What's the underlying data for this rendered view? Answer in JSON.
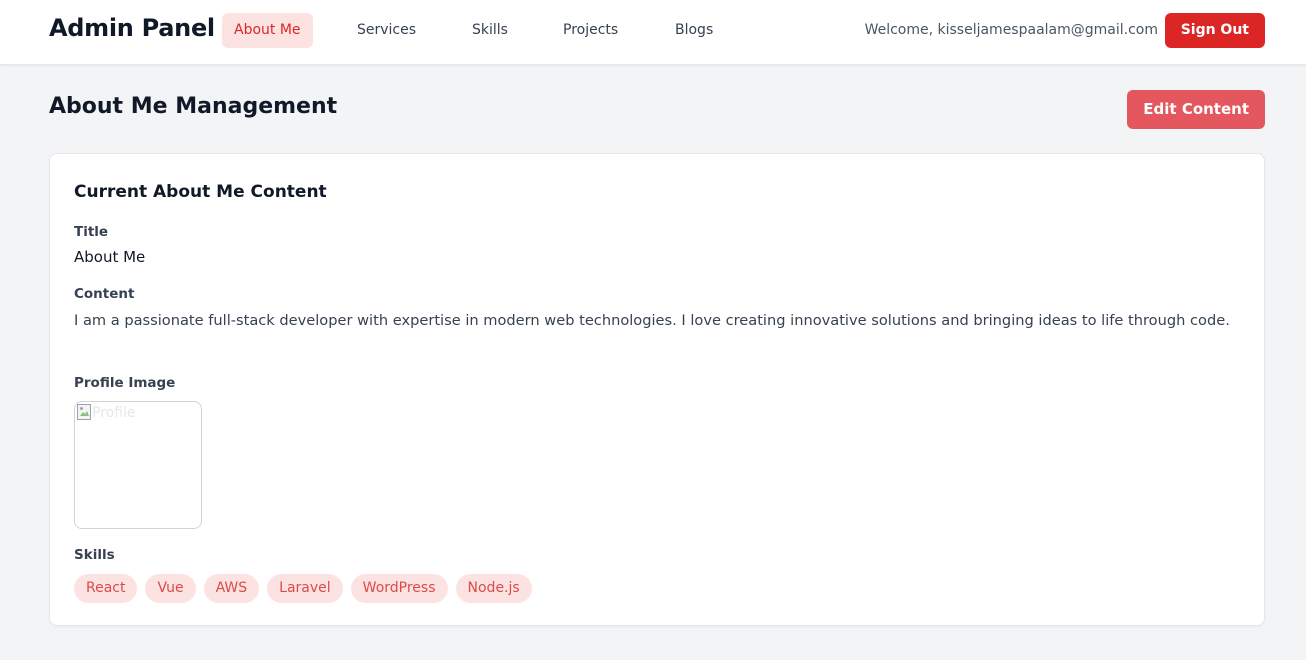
{
  "header": {
    "brand": "Admin Panel",
    "nav": [
      {
        "label": "About Me",
        "active": true
      },
      {
        "label": "Services",
        "active": false
      },
      {
        "label": "Skills",
        "active": false
      },
      {
        "label": "Projects",
        "active": false
      },
      {
        "label": "Blogs",
        "active": false
      }
    ],
    "welcome": "Welcome, kisseljamespaalam@gmail.com",
    "signout_label": "Sign Out"
  },
  "page": {
    "title": "About Me Management",
    "edit_label": "Edit Content"
  },
  "card": {
    "title": "Current About Me Content",
    "title_label": "Title",
    "title_value": "About Me",
    "content_label": "Content",
    "content_value": "I am a passionate full-stack developer with expertise in modern web technologies. I love creating innovative solutions and bringing ideas to life through code.",
    "image_label": "Profile Image",
    "image_alt": "Profile",
    "skills_label": "Skills",
    "skills": [
      "React",
      "Vue",
      "AWS",
      "Laravel",
      "WordPress",
      "Node.js"
    ]
  },
  "colors": {
    "accent": "#dc2626",
    "accent_soft": "#fde2e2",
    "edit_button": "#e5575f",
    "page_bg": "#f3f4f6"
  }
}
